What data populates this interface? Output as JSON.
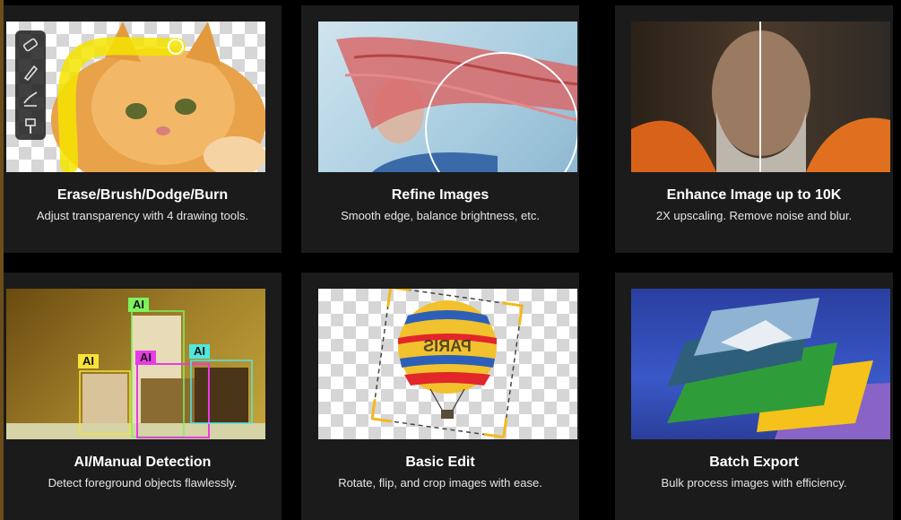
{
  "cards": [
    {
      "title": "Erase/Brush/Dodge/Burn",
      "description": "Adjust transparency with 4 drawing tools."
    },
    {
      "title": "Refine Images",
      "description": "Smooth edge, balance brightness, etc."
    },
    {
      "title": "Enhance Image up to 10K",
      "description": "2X upscaling. Remove noise and blur."
    },
    {
      "title": "AI/Manual Detection",
      "description": "Detect foreground objects flawlessly."
    },
    {
      "title": "Basic Edit",
      "description": "Rotate, flip, and crop images with ease."
    },
    {
      "title": "Batch Export",
      "description": "Bulk process images with efficiency."
    }
  ],
  "detection_tags": [
    "AI",
    "AI",
    "AI",
    "AI"
  ],
  "balloon_text": "PARIS",
  "toolbar_icons": [
    "eraser-icon",
    "brush-icon",
    "dodge-icon",
    "burn-icon"
  ],
  "colors": {
    "card_bg": "#1b1b1b",
    "page_bg": "#000000",
    "tag_green": "#7df35e",
    "tag_yellow": "#f7e23a",
    "tag_magenta": "#e83be6",
    "tag_cyan": "#4fe8e0",
    "crop_handle": "#f4b81c"
  }
}
